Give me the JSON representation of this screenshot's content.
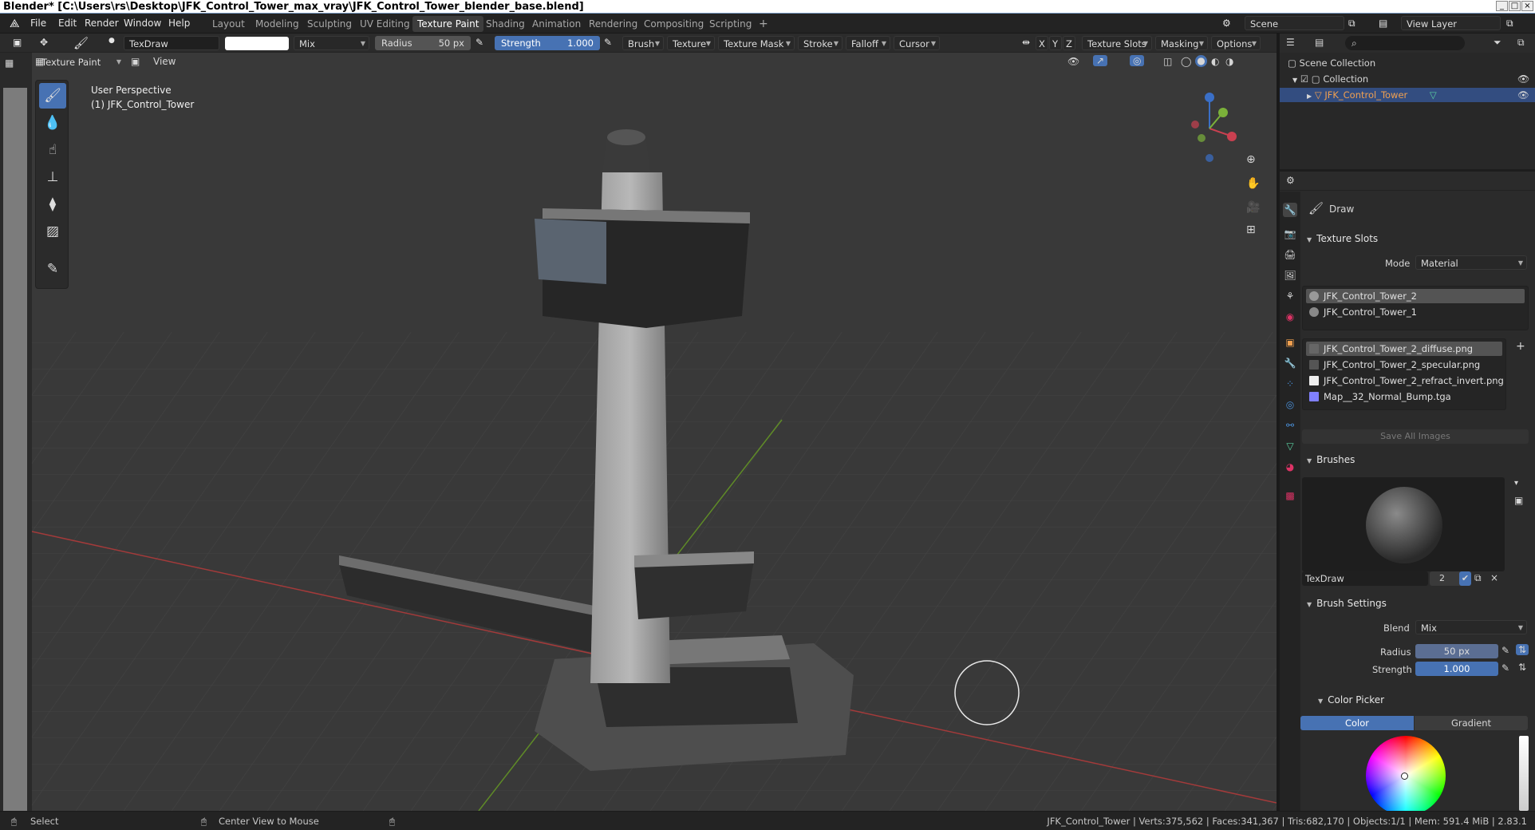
{
  "window_title": "Blender* [C:\\Users\\rs\\Desktop\\JFK_Control_Tower_max_vray\\JFK_Control_Tower_blender_base.blend]",
  "menu": [
    "File",
    "Edit",
    "Render",
    "Window",
    "Help"
  ],
  "workspaces": [
    "Layout",
    "Modeling",
    "Sculpting",
    "UV Editing",
    "Texture Paint",
    "Shading",
    "Animation",
    "Rendering",
    "Compositing",
    "Scripting"
  ],
  "active_workspace": "Texture Paint",
  "scene": "Scene",
  "view_layer": "View Layer",
  "tool_header": {
    "brush_name": "TexDraw",
    "blend": "Mix",
    "radius_label": "Radius",
    "radius_value": "50 px",
    "strength_label": "Strength",
    "strength_value": "1.000",
    "menus": [
      "Brush",
      "Texture",
      "Texture Mask",
      "Stroke",
      "Falloff",
      "Cursor"
    ],
    "axes": [
      "X",
      "Y",
      "Z"
    ],
    "right_menus": [
      "Texture Slots",
      "Masking",
      "Options"
    ]
  },
  "view_header": {
    "mode": "Texture Paint",
    "view": "View"
  },
  "viewport": {
    "perspective": "User Perspective",
    "object": "(1) JFK_Control_Tower"
  },
  "outliner": {
    "scene_collection": "Scene Collection",
    "collection": "Collection",
    "object": "JFK_Control_Tower"
  },
  "properties": {
    "tool_name": "Draw",
    "texture_slots_title": "Texture Slots",
    "mode_label": "Mode",
    "mode_value": "Material",
    "materials": [
      "JFK_Control_Tower_2",
      "JFK_Control_Tower_1"
    ],
    "images": [
      "JFK_Control_Tower_2_diffuse.png",
      "JFK_Control_Tower_2_specular.png",
      "JFK_Control_Tower_2_refract_invert.png",
      "Map__32_Normal_Bump.tga"
    ],
    "save_all": "Save All Images",
    "brushes_title": "Brushes",
    "brush_name": "TexDraw",
    "brush_users": "2",
    "brush_settings_title": "Brush Settings",
    "blend_label": "Blend",
    "blend_value": "Mix",
    "radius_label": "Radius",
    "radius_value": "50 px",
    "strength_label": "Strength",
    "strength_value": "1.000",
    "color_picker_title": "Color Picker",
    "color_tab": "Color",
    "gradient_tab": "Gradient"
  },
  "status": {
    "select": "Select",
    "center_view": "Center View to Mouse",
    "stats": "JFK_Control_Tower | Verts:375,562 | Faces:341,367 | Tris:682,170 | Objects:1/1 | Mem: 591.4 MiB | 2.83.1"
  },
  "colors": {
    "accent": "#4772b3",
    "viewport_bg": "#393939",
    "x_axis": "#b33e3e",
    "y_axis": "#6a9a2a"
  }
}
